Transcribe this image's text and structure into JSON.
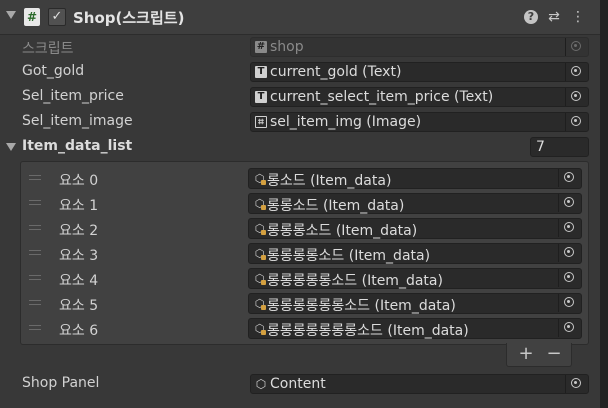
{
  "header": {
    "title": "Shop(스크립트)",
    "script_glyph": "#",
    "check_glyph": "✓",
    "help_glyph": "?",
    "settings_glyph": "⇄",
    "menu_glyph": "⋮"
  },
  "fields": {
    "script": {
      "label": "스크립트",
      "value": "shop"
    },
    "got_gold": {
      "label": "Got_gold",
      "value": "current_gold (Text)"
    },
    "sel_item_price": {
      "label": "Sel_item_price",
      "value": "current_select_item_price (Text)"
    },
    "sel_item_image": {
      "label": "Sel_item_image",
      "value": "sel_item_img (Image)"
    },
    "shop_panel": {
      "label": "Shop Panel",
      "value": "Content"
    }
  },
  "item_list": {
    "label": "Item_data_list",
    "size": "7",
    "elements": [
      {
        "label": "요소 0",
        "value": "롱소드 (Item_data)"
      },
      {
        "label": "요소 1",
        "value": "롱롱소드 (Item_data)"
      },
      {
        "label": "요소 2",
        "value": "롱롱롱소드 (Item_data)"
      },
      {
        "label": "요소 3",
        "value": "롱롱롱롱소드 (Item_data)"
      },
      {
        "label": "요소 4",
        "value": "롱롱롱롱롱소드 (Item_data)"
      },
      {
        "label": "요소 5",
        "value": "롱롱롱롱롱롱소드 (Item_data)"
      },
      {
        "label": "요소 6",
        "value": "롱롱롱롱롱롱롱소드 (Item_data)"
      }
    ],
    "add_glyph": "+",
    "remove_glyph": "−"
  },
  "icons": {
    "text_component": "text-component-icon",
    "image_component": "image-component-icon",
    "scriptable_object": "scriptable-object-icon",
    "object_picker": "object-picker-icon"
  },
  "colors": {
    "background": "#383838",
    "field_bg": "#2a2a2a",
    "text": "#d2d2d2"
  }
}
